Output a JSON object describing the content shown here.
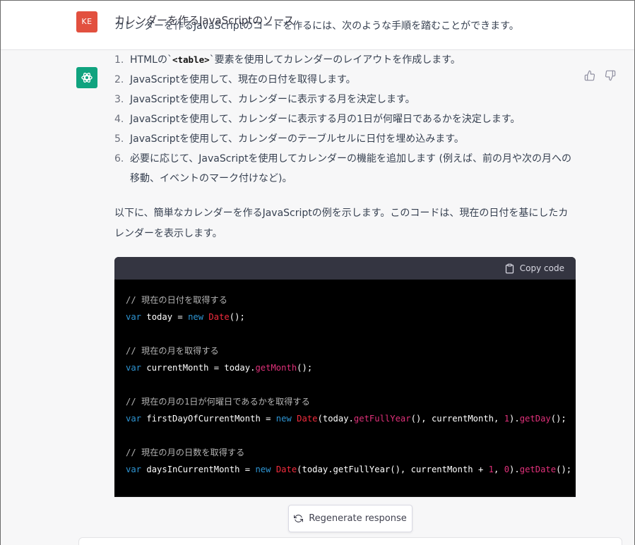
{
  "user": {
    "avatar_initials": "KE",
    "message": "カレンダーを作るJavaScriptのソース"
  },
  "assistant": {
    "intro": "カレンダーを作るJavaScriptのコードを作るには、次のような手順を踏むことができます。",
    "steps": [
      {
        "num": "1.",
        "pre": "HTMLの`",
        "code": "<table>",
        "post": "`要素を使用してカレンダーのレイアウトを作成します。"
      },
      {
        "num": "2.",
        "text": "JavaScriptを使用して、現在の日付を取得します。"
      },
      {
        "num": "3.",
        "text": "JavaScriptを使用して、カレンダーに表示する月を決定します。"
      },
      {
        "num": "4.",
        "text": "JavaScriptを使用して、カレンダーに表示する月の1日が何曜日であるかを決定します。"
      },
      {
        "num": "5.",
        "text": "JavaScriptを使用して、カレンダーのテーブルセルに日付を埋め込みます。"
      },
      {
        "num": "6.",
        "text": "必要に応じて、JavaScriptを使用してカレンダーの機能を追加します (例えば、前の月や次の月への移動、イベントのマーク付けなど)。"
      }
    ],
    "para2": "以下に、簡単なカレンダーを作るJavaScriptの例を示します。このコードは、現在の日付を基にしたカレンダーを表示します。",
    "copy_label": "Copy code",
    "code": {
      "c1": "// 現在の日付を取得する",
      "l1": {
        "kw": "var",
        "a": " today = ",
        "kw2": "new",
        "cls": "Date",
        "b": "();"
      },
      "c2": "// 現在の月を取得する",
      "l2": {
        "kw": "var",
        "a": " currentMonth = today.",
        "fn": "getMonth",
        "b": "();"
      },
      "c3": "// 現在の月の1日が何曜日であるかを取得する",
      "l3": {
        "kw": "var",
        "a": " firstDayOfCurrentMonth = ",
        "kw2": "new",
        "cls": "Date",
        "b": "(today.",
        "fn1": "getFullYear",
        "c": "(), currentMonth, ",
        "n": "1",
        "d": ").",
        "fn2": "getDay",
        "e": "();"
      },
      "c4": "// 現在の月の日数を取得する",
      "l4": {
        "kw": "var",
        "a": " daysInCurrentMonth = ",
        "kw2": "new",
        "cls": "Date",
        "b": "(today.getFullYear(), currentMonth + ",
        "n1": "1",
        "c": ", ",
        "n2": "0",
        "d": ").",
        "fn": "getDate",
        "e": "();"
      }
    }
  },
  "regenerate_label": "Regenerate response",
  "colors": {
    "user_avatar": "#e2503f",
    "assistant_avatar": "#10a37f",
    "code_bg": "#000000",
    "code_header": "#343541"
  }
}
